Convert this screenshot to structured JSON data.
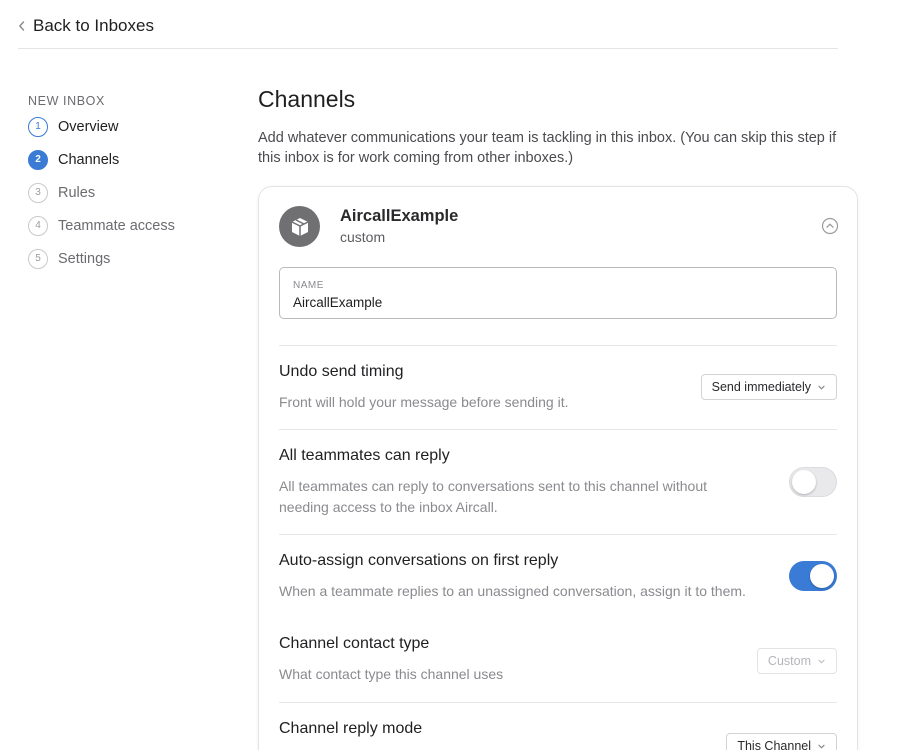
{
  "header": {
    "back_label": "Back to Inboxes"
  },
  "sidebar": {
    "heading": "New Inbox",
    "steps": [
      {
        "num": "1",
        "label": "Overview"
      },
      {
        "num": "2",
        "label": "Channels"
      },
      {
        "num": "3",
        "label": "Rules"
      },
      {
        "num": "4",
        "label": "Teammate access"
      },
      {
        "num": "5",
        "label": "Settings"
      }
    ]
  },
  "main": {
    "title": "Channels",
    "description": "Add whatever communications your team is tackling in this inbox. (You can skip this step if this inbox is for work coming from other inboxes.)"
  },
  "channel": {
    "name": "AircallExample",
    "type": "custom",
    "name_field_label": "Name",
    "name_field_value": "AircallExample",
    "icon": "package-icon",
    "settings": {
      "undo_send": {
        "title": "Undo send timing",
        "desc": "Front will hold your message before sending it.",
        "value": "Send immediately"
      },
      "all_reply": {
        "title": "All teammates can reply",
        "desc": "All teammates can reply to conversations sent to this channel without needing access to the inbox Aircall.",
        "enabled": false
      },
      "auto_assign": {
        "title": "Auto-assign conversations on first reply",
        "desc": "When a teammate replies to an unassigned conversation, assign it to them.",
        "enabled": true
      },
      "contact_type": {
        "title": "Channel contact type",
        "desc": "What contact type this channel uses",
        "value": "Custom"
      },
      "reply_mode": {
        "title": "Channel reply mode",
        "value": "This Channel"
      }
    }
  },
  "colors": {
    "accent": "#3a7bd5",
    "avatar": "#707073",
    "border": "#e3e3e6"
  }
}
